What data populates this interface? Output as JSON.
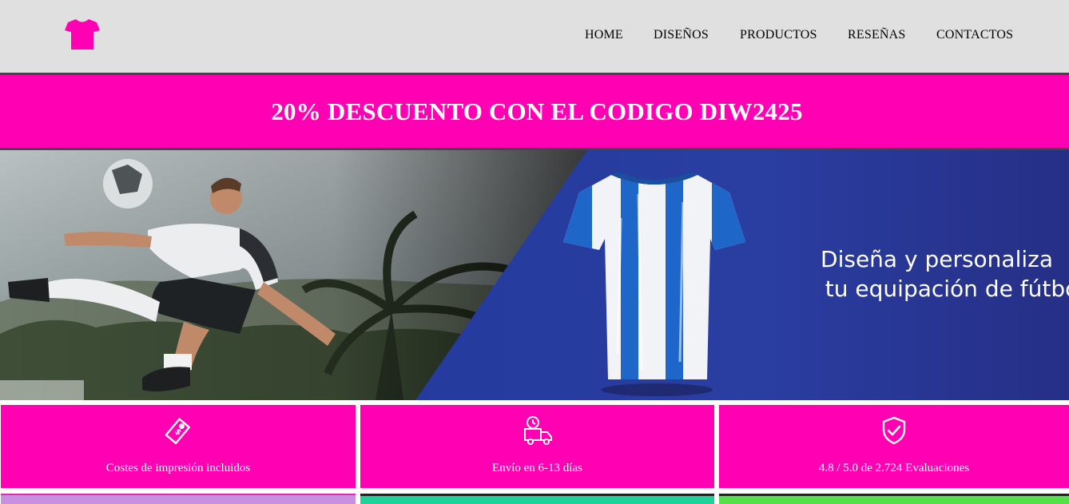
{
  "header": {
    "logo_icon": "tshirt-icon",
    "nav": [
      "HOME",
      "DISEÑOS",
      "PRODUCTOS",
      "RESEÑAS",
      "CONTACTOS"
    ]
  },
  "promo": {
    "text": "20% DESCUENTO CON EL CODIGO DIW2425"
  },
  "hero": {
    "line1": "Diseña y personaliza",
    "line2": "tu equipación de fútbol"
  },
  "features": [
    {
      "icon": "price-tag-icon",
      "label": "Costes de impresión incluidos"
    },
    {
      "icon": "delivery-truck-icon",
      "label": "Envío en 6-13 días"
    },
    {
      "icon": "shield-check-icon",
      "label": "4.8 / 5.0 de 2.724 Evaluaciones"
    }
  ],
  "colors": {
    "header_bg": "#e0e0e0",
    "accent": "#ff00b3",
    "hero_blue": "#243a9c",
    "strip_1": "#c98fe0",
    "strip_2": "#1ed29a",
    "strip_3": "#55e04a"
  }
}
